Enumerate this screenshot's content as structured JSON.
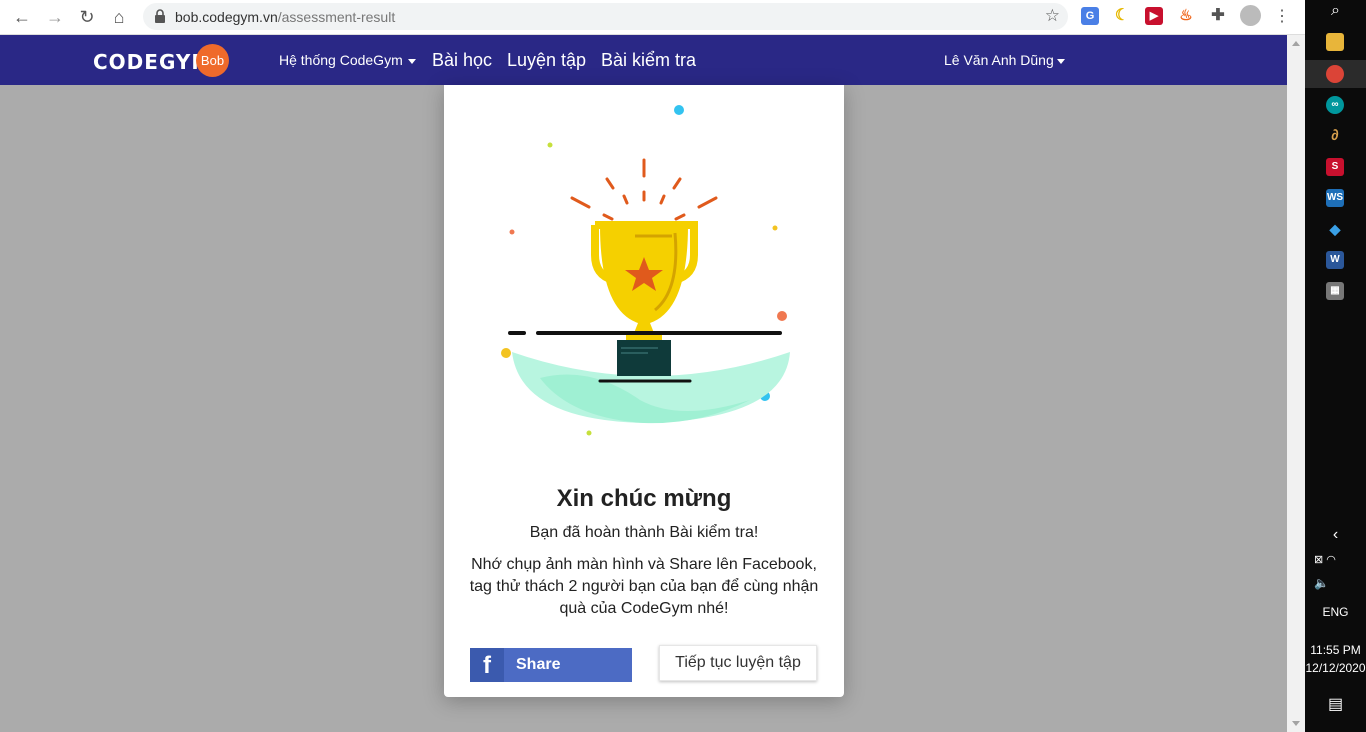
{
  "browser": {
    "url_domain": "bob.codegym.vn",
    "url_path": "/assessment-result"
  },
  "navbar": {
    "logo_text": "CODEGYM",
    "logo_badge": "Bob",
    "items": [
      {
        "label": "Hệ thống CodeGym"
      },
      {
        "label": "Bài học"
      },
      {
        "label": "Luyện tập"
      },
      {
        "label": "Bài kiểm tra"
      }
    ],
    "user_name": "Lê Văn Anh Dũng"
  },
  "modal": {
    "title": "Xin chúc mừng",
    "subtitle": "Bạn đã hoàn thành Bài kiểm tra!",
    "body": "Nhớ chụp ảnh màn hình và Share lên Facebook, tag thử thách 2 người bạn của bạn để cùng nhận quà của CodeGym nhé!",
    "share_label": "Share",
    "continue_label": "Tiếp tục luyện tập"
  },
  "taskbar": {
    "language": "ENG",
    "time": "11:55 PM",
    "date": "12/12/2020"
  },
  "colors": {
    "navbar": "#2a2886",
    "overlay": "#ababab",
    "facebook": "#4c6bc4",
    "trophy": "#f5d000"
  }
}
